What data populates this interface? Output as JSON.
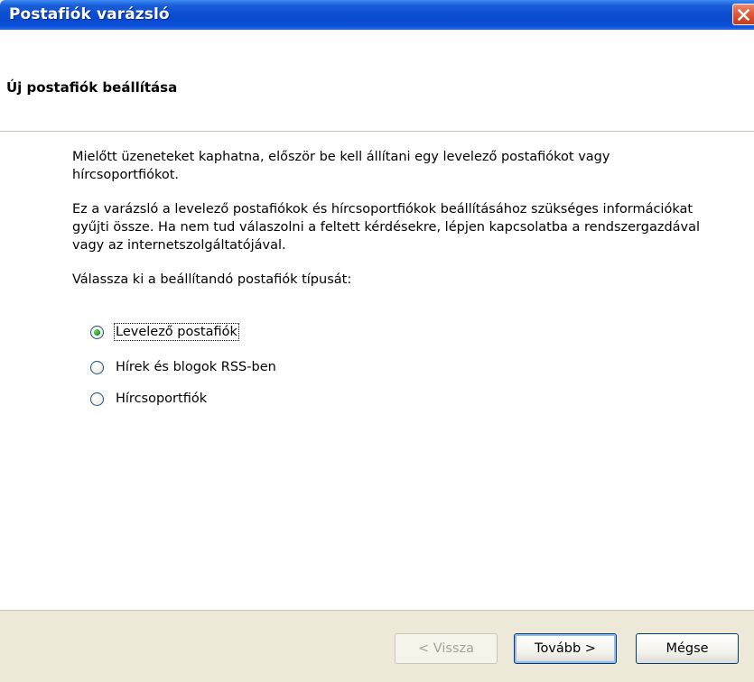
{
  "window": {
    "title": "Postafiók varázsló"
  },
  "header": {
    "title": "Új postafiók beállítása"
  },
  "content": {
    "paragraph1": "Mielőtt üzeneteket kaphatna, először be kell állítani egy levelező postafiókot vagy hírcsoportfiókot.",
    "paragraph2": "Ez a varázsló a levelező postafiókok és hírcsoportfiókok beállításához szükséges információkat gyűjti össze. Ha nem tud válaszolni a feltett kérdésekre, lépjen kapcsolatba a rendszergazdával vagy az internetszolgáltatójával.",
    "prompt": "Válassza ki a beállítandó postafiók típusát:",
    "options": [
      {
        "label": "Levelező postafiók",
        "checked": true
      },
      {
        "label": "Hírek és blogok RSS-ben",
        "checked": false
      },
      {
        "label": "Hírcsoportfiók",
        "checked": false
      }
    ]
  },
  "buttons": {
    "back": "< Vissza",
    "next": "Tovább >",
    "cancel": "Mégse"
  },
  "colors": {
    "titlebar": "#0b4fd0",
    "dialog_face": "#ECE9D8",
    "close_button": "#e05a3a"
  },
  "icons": {
    "close": "close-icon"
  }
}
